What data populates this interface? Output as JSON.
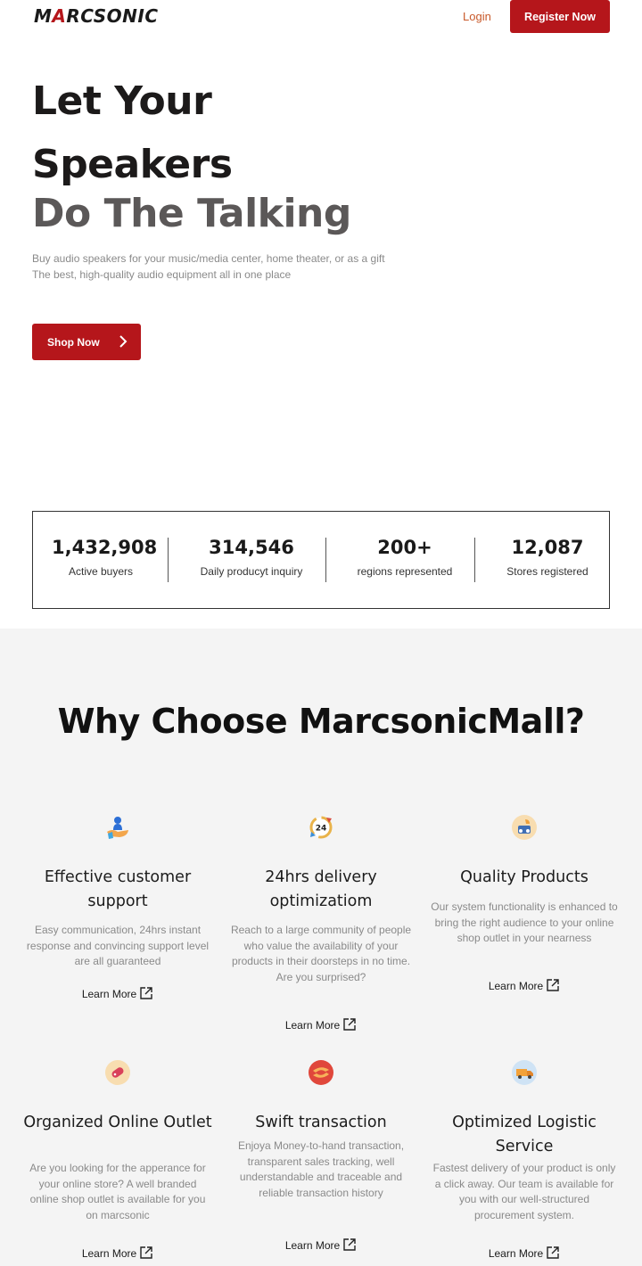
{
  "header": {
    "logo_prefix": "M",
    "logo_accent": "A",
    "logo_rest": "RCSONIC",
    "login_label": "Login",
    "register_label": "Register Now"
  },
  "hero": {
    "line1": "Let Your",
    "line2": "Speakers",
    "line3": "Do The Talking",
    "desc1": "Buy audio speakers for your music/media center, home theater, or as a gift",
    "desc2": "The best, high-quality audio equipment all in one place",
    "shop_label": "Shop Now"
  },
  "stats": [
    {
      "value": "1,432,908",
      "label": "Active buyers"
    },
    {
      "value": "314,546",
      "label": "Daily producyt inquiry"
    },
    {
      "value": "200+",
      "label": "regions represented"
    },
    {
      "value": "12,087",
      "label": "Stores registered"
    }
  ],
  "why": {
    "title": "Why Choose MarcsonicMall?",
    "learn_label": "Learn More",
    "features": [
      {
        "icon": "customer-support-icon",
        "title": "Effective customer support",
        "desc": "Easy communication, 24hrs instant response and convincing support level are all guaranteed"
      },
      {
        "icon": "24hrs-icon",
        "title": "24hrs delivery optimizatiom",
        "desc": "Reach to a large community of people who value the availability of your products in their doorsteps in no time. Are you surprised?"
      },
      {
        "icon": "quality-products-icon",
        "title": "Quality Products",
        "desc": "Our system functionality is enhanced to bring the right audience to your online shop outlet in your nearness"
      },
      {
        "icon": "online-outlet-icon",
        "title": "Organized Online Outlet",
        "desc": "Are you looking for the apperance for your online store? A well branded online shop outlet is available for you on marcsonic"
      },
      {
        "icon": "swift-transaction-icon",
        "title": "Swift transaction",
        "desc": "Enjoya Money-to-hand transaction, transparent sales tracking, well understandable and traceable and reliable transaction history"
      },
      {
        "icon": "delivery-truck-icon",
        "title": "Optimized Logistic Service",
        "desc": "Fastest delivery of your product is only a click away. Our team is available for you with our well-structured procurement system."
      }
    ]
  },
  "colors": {
    "brand_red": "#b5161b",
    "login_orange": "#c8592a",
    "section_bg": "#f4f4f4"
  }
}
